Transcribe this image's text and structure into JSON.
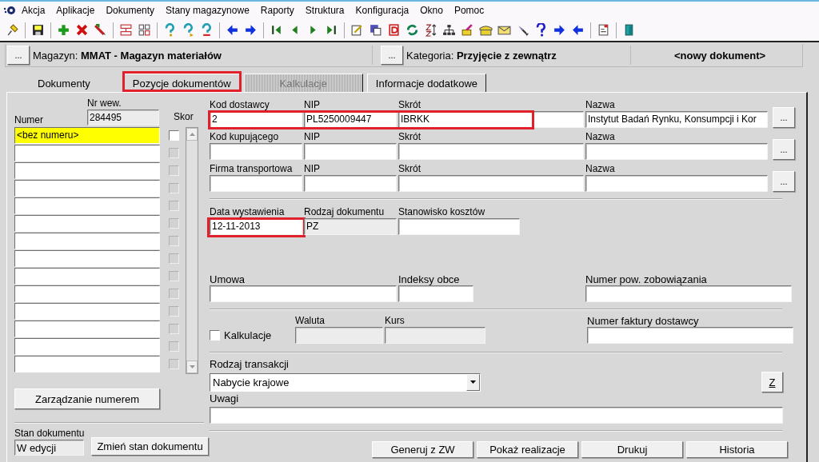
{
  "menu": [
    "Akcja",
    "Aplikacje",
    "Dokumenty",
    "Stany magazynowe",
    "Raporty",
    "Struktura",
    "Konfiguracja",
    "Okno",
    "Pomoc"
  ],
  "header": {
    "warehouse_button": "...",
    "warehouse": "Magazyn: **MMAT - Magazyn materiałów**",
    "category_button": "...",
    "category": "Kategoria: **Przyjęcie z zewnątrz**",
    "document": "<nowy dokument>"
  },
  "tabs": [
    {
      "label": "Dokumenty",
      "selected": true,
      "disabled": false,
      "highlighted": false
    },
    {
      "label": "Pozycje dokumentów",
      "selected": false,
      "disabled": false,
      "highlighted": true
    },
    {
      "label": "Kalkulacje",
      "selected": false,
      "disabled": true,
      "highlighted": false
    },
    {
      "label": "Informacje dodatkowe",
      "selected": false,
      "disabled": false,
      "highlighted": false
    }
  ],
  "document_list": {
    "internal_number_label": "Nr wew.",
    "internal_number": "284495",
    "number_label": "Numer",
    "correction_label": "Skor",
    "rows": [
      {
        "number": "<bez numeru>",
        "selected": true,
        "checked": false,
        "disabled": false
      },
      {
        "selected": false,
        "checked": false,
        "disabled": true
      },
      {
        "selected": false,
        "checked": false,
        "disabled": true
      },
      {
        "selected": false,
        "checked": false,
        "disabled": true
      },
      {
        "selected": false,
        "checked": false,
        "disabled": true
      },
      {
        "selected": false,
        "checked": false,
        "disabled": true
      },
      {
        "selected": false,
        "checked": false,
        "disabled": true
      },
      {
        "selected": false,
        "checked": false,
        "disabled": true
      },
      {
        "selected": false,
        "checked": false,
        "disabled": true
      },
      {
        "selected": false,
        "checked": false,
        "disabled": true
      },
      {
        "selected": false,
        "checked": false,
        "disabled": true
      },
      {
        "selected": false,
        "checked": false,
        "disabled": true
      },
      {
        "selected": false,
        "checked": false,
        "disabled": true
      },
      {
        "selected": false,
        "checked": false,
        "disabled": true
      }
    ],
    "manage_button": "Zarządzanie numerem"
  },
  "status": {
    "label": "Stan dokumentu",
    "value": "W edycji",
    "button": "Zmień stan dokumentu"
  },
  "parties": [
    {
      "code_label": "Kod dostawcy",
      "code": "2",
      "nip_label": "NIP",
      "nip": "PL5250009447",
      "short_label": "Skrót",
      "short": "IBRKK",
      "name_label": "Nazwa",
      "name": "Instytut Badań Rynku, Konsumpcji i Kor",
      "picker": "...",
      "highlighted": true
    },
    {
      "code_label": "Kod kupującego",
      "nip_label": "NIP",
      "short_label": "Skrót",
      "name_label": "Nazwa",
      "picker": "...",
      "highlighted": false
    },
    {
      "code_label": "Firma transportowa",
      "nip_label": "NIP",
      "short_label": "Skrót",
      "name_label": "Nazwa",
      "picker": "...",
      "highlighted": false
    }
  ],
  "document_fields": [
    {
      "label": "Data wystawienia",
      "value": "12-11-2013",
      "readonly": false,
      "highlighted": true
    },
    {
      "label": "Rodzaj dokumentu",
      "value": "PZ",
      "readonly": true,
      "highlighted": false
    },
    {
      "label": "Stanowisko kosztów",
      "readonly": false,
      "highlighted": false
    }
  ],
  "contract": {
    "contract_label": "Umowa",
    "foreign_index_label": "Indeksy obce",
    "liability_label": "Numer pow. zobowiązania"
  },
  "calculation": {
    "label": "Kalkulacje",
    "checked": false,
    "currency_label": "Waluta",
    "rate_label": "Kurs",
    "invoice_label": "Numer faktury dostawcy"
  },
  "transaction": {
    "label": "Rodzaj transakcji",
    "value": "Nabycie krajowe",
    "z_button": "Z"
  },
  "notes": {
    "label": "Uwagi"
  },
  "actions": [
    "Generuj z ZW",
    "Pokaż realizacje",
    "Drukuj",
    "Historia"
  ]
}
